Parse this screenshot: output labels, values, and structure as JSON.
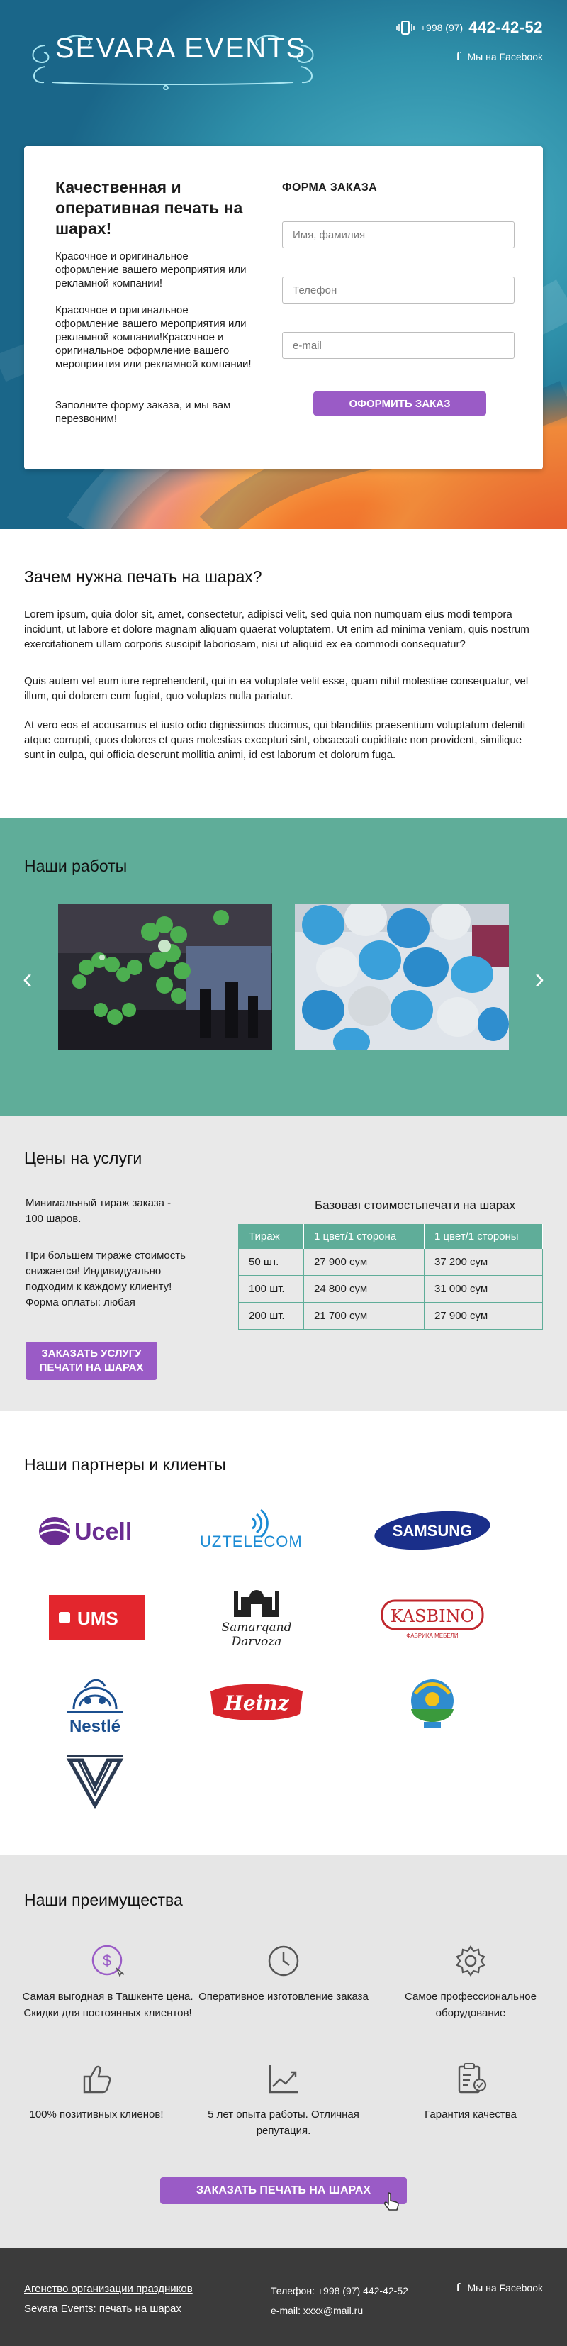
{
  "header": {
    "logo_text": "SEVARA  EVENTS",
    "phone_code": "+998 (97)",
    "phone_number": "442-42-52",
    "facebook_label": "Мы на Facebook"
  },
  "order": {
    "lead": "Качественная и оперативная печать на шарах!",
    "p1": "Красочное и оригинальное оформление вашего мероприятия или рекламной компании!",
    "p2": "Красочное и оригинальное оформление вашего мероприятия или рекламной компании!Красочное и оригинальное оформление вашего мероприятия или рекламной компании!",
    "p3": "Заполните форму заказа, и мы вам перезвоним!",
    "form_title": "ФОРМА ЗАКАЗА",
    "name_placeholder": "Имя, фамилия",
    "phone_placeholder": "Телефон",
    "email_placeholder": "e-mail",
    "submit": "ОФОРМИТЬ ЗАКАЗ"
  },
  "why": {
    "title": "Зачем нужна печать на шарах?",
    "p1": "Lorem ipsum, quia dolor sit, amet, consectetur, adipisci velit, sed quia non numquam eius modi tempora incidunt, ut labore et dolore magnam aliquam quaerat voluptatem. Ut enim ad minima veniam, quis nostrum exercitationem ullam corporis suscipit laboriosam, nisi ut aliquid ex ea commodi consequatur?",
    "p2": "Quis autem vel eum iure reprehenderit, qui in ea voluptate velit esse, quam nihil molestiae consequatur, vel illum, qui dolorem eum fugiat, quo voluptas nulla pariatur.",
    "p3": "At vero eos et accusamus et iusto odio dignissimos ducimus, qui blanditiis praesentium voluptatum deleniti atque corrupti, quos dolores et quas molestias excepturi sint, obcaecati cupiditate non provident, similique sunt in culpa, qui officia deserunt mollitia animi, id est laborum et dolorum fuga."
  },
  "works": {
    "title": "Наши работы",
    "prev": "‹",
    "next": "›"
  },
  "prices": {
    "title": "Цены на услуги",
    "p1": "Минимальный тираж заказа - 100 шаров.",
    "p2": "При большем тираже стоимость снижается! Индивидуально подходим к каждому клиенту!",
    "p3": "Форма оплаты: любая",
    "button": "ЗАКАЗАТЬ УСЛУГУ ПЕЧАТИ НА ШАРАХ",
    "table_title": "Базовая стоимостьпечати на шарах",
    "headers": [
      "Тираж",
      "1 цвет/1 сторона",
      "1 цвет/1 стороны"
    ],
    "rows": [
      [
        "50 шт.",
        "27 900 сум",
        "37 200 сум"
      ],
      [
        "100 шт.",
        "24 800 сум",
        "31 000 сум"
      ],
      [
        "200 шт.",
        "21 700 сум",
        "27 900 сум"
      ]
    ]
  },
  "partners": {
    "title": "Наши партнеры и клиенты",
    "logos": {
      "ucell": "Ucell",
      "uztelecom": "UZTELECOM",
      "samsung": "SAMSUNG",
      "ums": "UMS",
      "samarqand1": "Samarqand",
      "samarqand2": "Darvoza",
      "kasbino": "KASBINO",
      "kasbino_sub": "ФАБРИКА МЕБЕЛИ",
      "nestle": "Nestlé",
      "heinz": "Heinz"
    }
  },
  "advantages": {
    "title": "Наши преимущества",
    "items": [
      {
        "text": "Самая выгодная в Ташкенте цена. Скидки для постоянных клиентов!"
      },
      {
        "text": "Оперативное изготовление заказа"
      },
      {
        "text": "Самое профессиональное оборудование"
      },
      {
        "text": "100% позитивных клиенов!"
      },
      {
        "text": "5 лет опыта работы. Отличная репутация."
      },
      {
        "text": "Гарантия качества"
      }
    ],
    "button": "ЗАКАЗАТЬ ПЕЧАТЬ НА ШАРАХ"
  },
  "footer": {
    "link1": "Агенство организации праздников",
    "link2": "Sevara Events: печать на шарах",
    "phone": "Телефон: +998 (97) 442-42-52",
    "email": "e-mail: xxxx@mail.ru",
    "facebook": "Мы на Facebook"
  },
  "colors": {
    "accent": "#9a5bc6",
    "teal": "#5fad99",
    "footer": "#3b3b3b"
  }
}
